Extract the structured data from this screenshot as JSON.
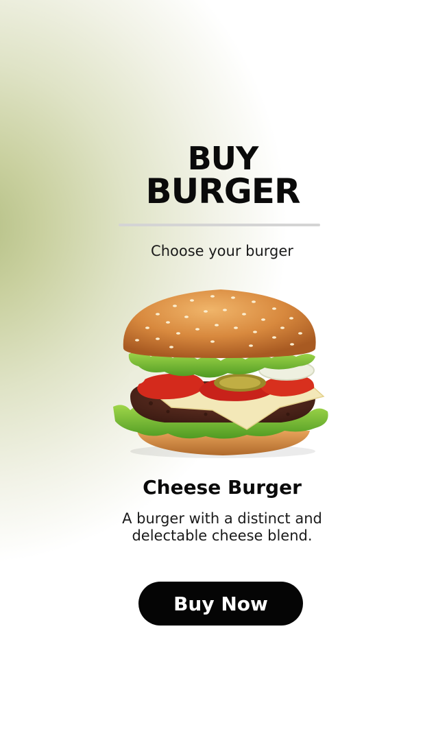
{
  "header": {
    "title_line1": "BUY",
    "title_line2": "BURGER",
    "subtitle": "Choose your burger"
  },
  "product": {
    "image_icon": "cheese-burger-image",
    "name": "Cheese Burger",
    "description": "A burger with a distinct and delectable cheese blend."
  },
  "actions": {
    "buy_label": "Buy Now"
  },
  "colors": {
    "background_tint": "#b4bf84",
    "text": "#0a0a0a",
    "button_bg": "#050505",
    "button_text": "#ffffff",
    "divider": "#d4d4d4"
  }
}
